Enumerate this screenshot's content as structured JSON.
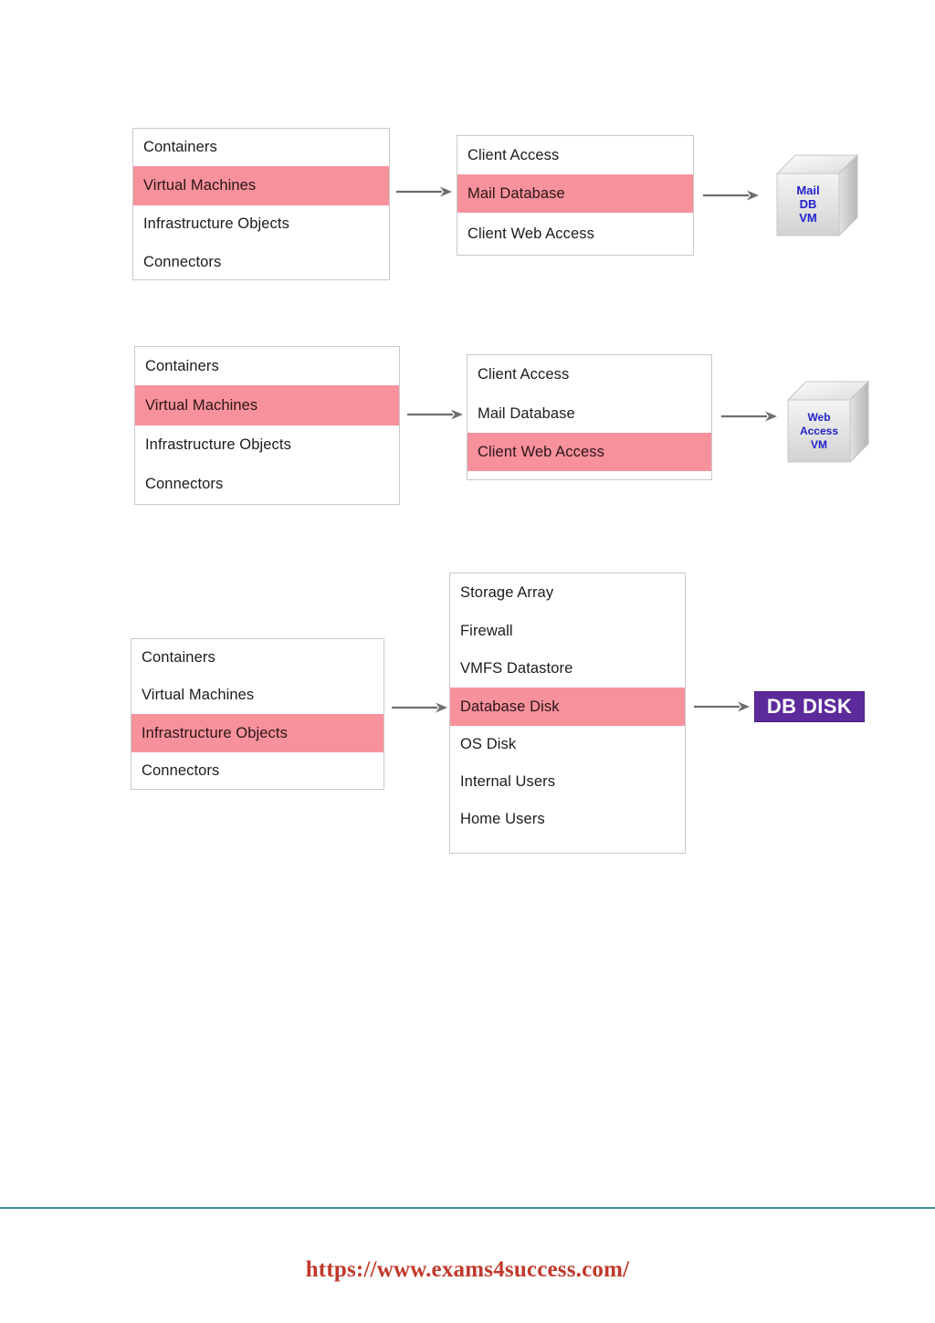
{
  "page": {
    "background_color": "#ffffff",
    "highlight_color": "#f7929d",
    "box_border_color": "#c9c9c9",
    "arrow_color": "#6e6e6e",
    "text_color": "#1c1c1c"
  },
  "diagram": {
    "type": "flow-diagram",
    "rows": [
      {
        "id": "row-1",
        "source_list": {
          "title": "",
          "items": [
            {
              "label": "Containers",
              "highlighted": false
            },
            {
              "label": "Virtual Machines",
              "highlighted": true
            },
            {
              "label": "Infrastructure Objects",
              "highlighted": false
            },
            {
              "label": "Connectors",
              "highlighted": false
            }
          ]
        },
        "target_list": {
          "items": [
            {
              "label": "Client Access",
              "highlighted": false
            },
            {
              "label": "Mail Database",
              "highlighted": true
            },
            {
              "label": "Client Web Access",
              "highlighted": false
            }
          ]
        },
        "result": {
          "kind": "cube",
          "lines": [
            "Mail",
            "DB",
            "VM"
          ],
          "text_color": "#2222cc"
        }
      },
      {
        "id": "row-2",
        "source_list": {
          "items": [
            {
              "label": "Containers",
              "highlighted": false
            },
            {
              "label": "Virtual Machines",
              "highlighted": true
            },
            {
              "label": "Infrastructure Objects",
              "highlighted": false
            },
            {
              "label": "Connectors",
              "highlighted": false
            }
          ]
        },
        "target_list": {
          "items": [
            {
              "label": "Client Access",
              "highlighted": false
            },
            {
              "label": "Mail Database",
              "highlighted": false
            },
            {
              "label": "Client Web Access",
              "highlighted": true
            }
          ]
        },
        "result": {
          "kind": "cube",
          "lines": [
            "Web",
            "Access",
            "VM"
          ],
          "text_color": "#2222cc"
        }
      },
      {
        "id": "row-3",
        "source_list": {
          "items": [
            {
              "label": "Containers",
              "highlighted": false
            },
            {
              "label": "Virtual Machines",
              "highlighted": false
            },
            {
              "label": "Infrastructure Objects",
              "highlighted": true
            },
            {
              "label": "Connectors",
              "highlighted": false
            }
          ]
        },
        "target_list": {
          "items": [
            {
              "label": "Storage Array",
              "highlighted": false
            },
            {
              "label": "Firewall",
              "highlighted": false
            },
            {
              "label": "VMFS Datastore",
              "highlighted": false
            },
            {
              "label": "Database Disk",
              "highlighted": true
            },
            {
              "label": "OS Disk",
              "highlighted": false
            },
            {
              "label": "Internal Users",
              "highlighted": false
            },
            {
              "label": "Home Users",
              "highlighted": false
            }
          ]
        },
        "result": {
          "kind": "chip",
          "label": "DB DISK",
          "background_color": "#5d2a9c",
          "text_color": "#ffffff"
        }
      }
    ]
  },
  "footer": {
    "url": "https://www.exams4success.com/",
    "url_color": "#c0392b",
    "rule_color": "#3f8ea0"
  }
}
